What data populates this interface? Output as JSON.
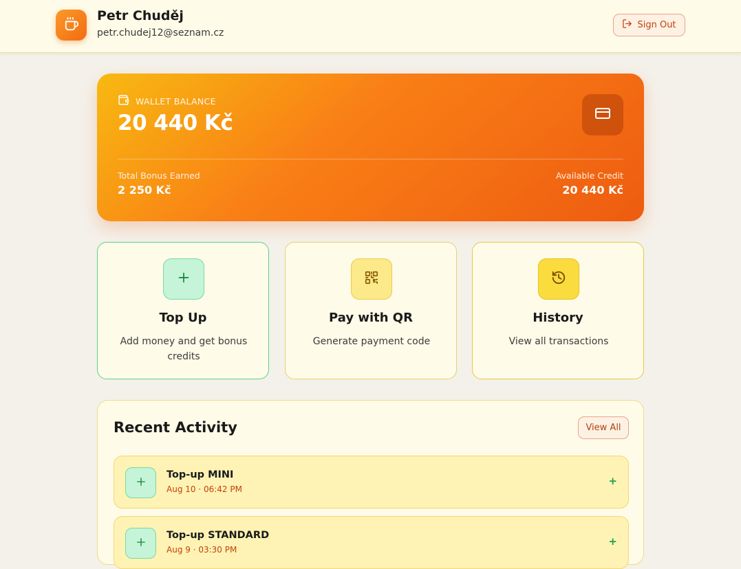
{
  "header": {
    "user_name": "Petr Chuděj",
    "user_email": "petr.chudej12@seznam.cz",
    "logo_icon": "coffee-cup-icon",
    "signout_label": "Sign Out",
    "signout_icon": "log-out-icon"
  },
  "wallet": {
    "label": "WALLET BALANCE",
    "label_icon": "wallet-icon",
    "balance": "20 440 Kč",
    "card_icon": "credit-card-icon",
    "bonus_label": "Total Bonus Earned",
    "bonus_value": "2 250 Kč",
    "credit_label": "Available Credit",
    "credit_value": "20 440 Kč"
  },
  "actions": [
    {
      "title": "Top Up",
      "desc": "Add money and get bonus credits",
      "icon": "plus-icon",
      "accent": "#16a34a"
    },
    {
      "title": "Pay with QR",
      "desc": "Generate payment code",
      "icon": "qr-code-icon",
      "accent": "#a16207"
    },
    {
      "title": "History",
      "desc": "View all transactions",
      "icon": "history-icon",
      "accent": "#a16207"
    }
  ],
  "activity": {
    "title": "Recent Activity",
    "view_all": "View All",
    "items": [
      {
        "name": "Top-up MINI",
        "time": "Aug 10 · 06:42 PM",
        "amount": "+",
        "icon": "plus-icon"
      },
      {
        "name": "Top-up STANDARD",
        "time": "Aug 9 · 03:30 PM",
        "amount": "+",
        "icon": "plus-icon"
      }
    ]
  },
  "colors": {
    "accent": "#f97316",
    "brand_dark": "#c2410c",
    "success": "#16a34a",
    "page_bg": "#f4f1ea"
  }
}
